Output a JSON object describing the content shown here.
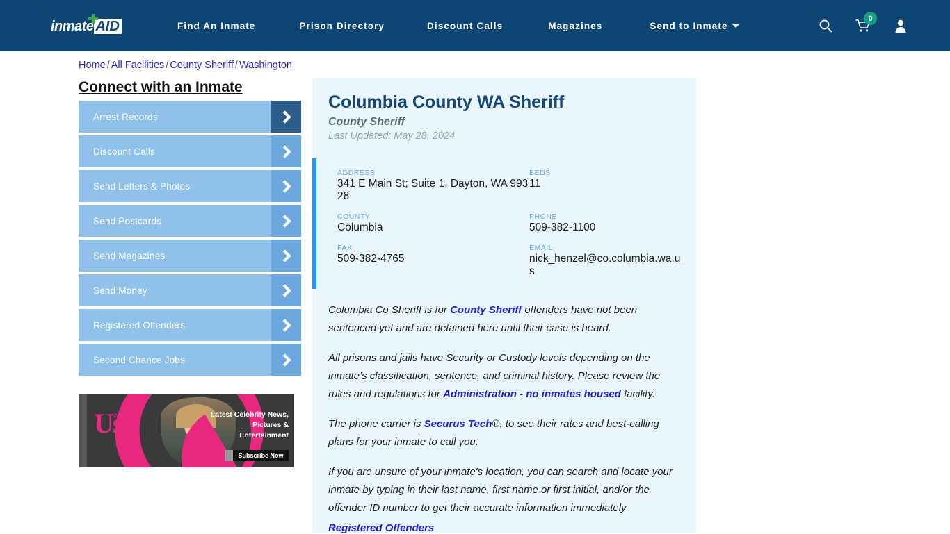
{
  "nav": {
    "logo_primary": "inmate",
    "logo_secondary": "AID",
    "links": [
      {
        "label": "Find An Inmate"
      },
      {
        "label": "Prison Directory"
      },
      {
        "label": "Discount Calls"
      },
      {
        "label": "Magazines"
      },
      {
        "label": "Send to Inmate"
      }
    ],
    "cart_count": "0",
    "icons": [
      "search-icon",
      "cart-icon",
      "user-icon"
    ]
  },
  "breadcrumb": {
    "items": [
      "Home",
      "All Facilities",
      "County Sheriff",
      "Washington"
    ],
    "separator": "/"
  },
  "sidebar": {
    "title": "Connect with an Inmate",
    "items": [
      {
        "label": "Arrest Records",
        "active": true
      },
      {
        "label": "Discount Calls",
        "active": false
      },
      {
        "label": "Send Letters & Photos",
        "active": false
      },
      {
        "label": "Send Postcards",
        "active": false
      },
      {
        "label": "Send Magazines",
        "active": false
      },
      {
        "label": "Send Money",
        "active": false
      },
      {
        "label": "Registered Offenders",
        "active": false
      },
      {
        "label": "Second Chance Jobs",
        "active": false
      }
    ]
  },
  "ad": {
    "logo": "Us",
    "logo_dots": "WEEKLY",
    "headline": "Latest Celebrity News, Pictures & Entertainment",
    "cta": "Subscribe Now"
  },
  "facility": {
    "name": "Columbia County WA Sheriff",
    "type": "County Sheriff",
    "last_updated": "Last Updated: May 28, 2024",
    "fields": [
      {
        "label": "ADDRESS",
        "value": "341 E Main St; Suite 1, Dayton, WA 99328"
      },
      {
        "label": "BEDS",
        "value": "11"
      },
      {
        "label": "COUNTY",
        "value": "Columbia"
      },
      {
        "label": "PHONE",
        "value": "509-382-1100"
      },
      {
        "label": "FAX",
        "value": "509-382-4765"
      },
      {
        "label": "EMAIL",
        "value": "nick_henzel@co.columbia.wa.us"
      }
    ]
  },
  "body": {
    "p1_a": "Columbia Co Sheriff is for ",
    "p1_link": "County Sheriff",
    "p1_b": " offenders have not been sentenced yet and are detained here until their case is heard.",
    "p2_a": "All prisons and jails have Security or Custody levels depending on the inmate’s classification, sentence, and criminal history. Please review the rules and regulations for ",
    "p2_link": "Administration - no inmates housed",
    "p2_b": " facility.",
    "p3_a": "The phone carrier is ",
    "p3_link": "Securus Tech",
    "p3_b": "®, to see their rates and best-calling plans for your inmate to call you.",
    "p4": "If you are unsure of your inmate's location, you can search and locate your inmate by typing in their last name, first name or first initial, and/or the offender ID number to get their accurate information immediately",
    "p4_link": "Registered Offenders"
  },
  "colors": {
    "nav_bg": "#0d4675",
    "panel_bg": "#eaf6fd",
    "accent_bar": "#2196f3",
    "sidebar_item": "#8fc1ea",
    "sidebar_arrow": "#6ba6dd",
    "sidebar_arrow_active": "#2e5d8d",
    "link": "#2020cf",
    "title": "#154877",
    "badge": "#16a085"
  }
}
